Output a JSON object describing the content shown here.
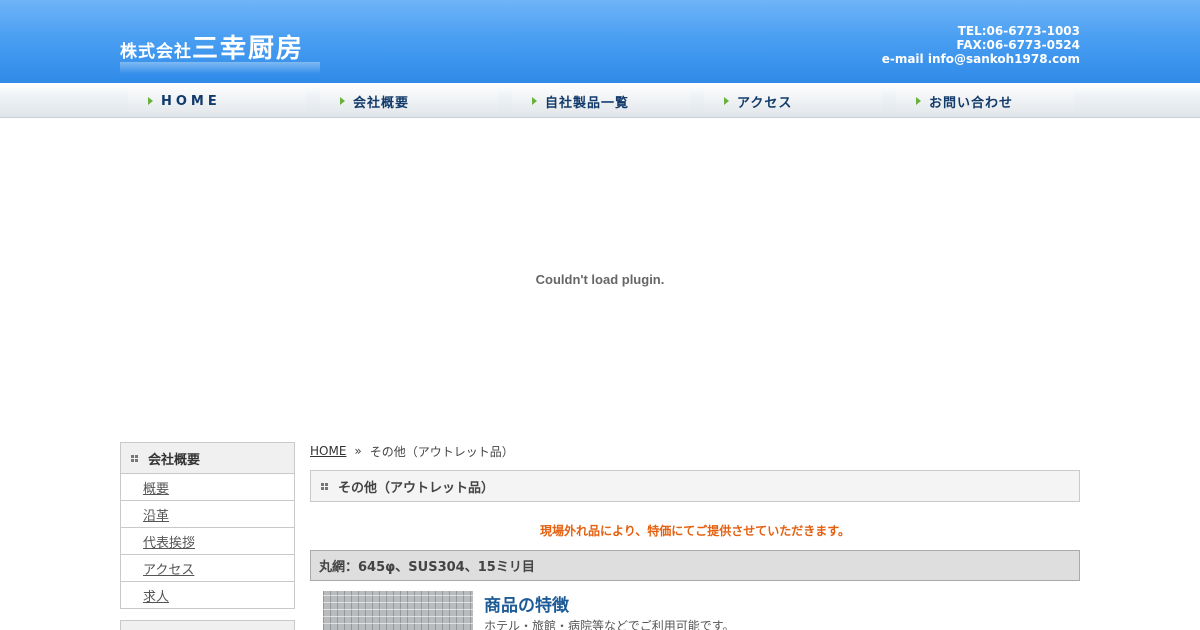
{
  "header": {
    "company_prefix": "株式会社",
    "company_name": "三幸厨房",
    "tel": "TEL:06-6773-1003",
    "fax": "FAX:06-6773-0524",
    "email": "e-mail info@sankoh1978.com"
  },
  "nav": {
    "items": [
      {
        "label": "HOME"
      },
      {
        "label": "会社概要"
      },
      {
        "label": "自社製品一覧"
      },
      {
        "label": "アクセス"
      },
      {
        "label": "お問い合わせ"
      }
    ]
  },
  "plugin": {
    "message": "Couldn't load plugin."
  },
  "sidebar": {
    "heading": "会社概要",
    "items": [
      {
        "label": "概要"
      },
      {
        "label": "沿革"
      },
      {
        "label": "代表挨拶"
      },
      {
        "label": "アクセス"
      },
      {
        "label": "求人"
      }
    ]
  },
  "breadcrumb": {
    "home": "HOME",
    "separator": "»",
    "current": "その他（アウトレット品）"
  },
  "main": {
    "title": "その他（アウトレット品）",
    "notice": "現場外れ品により、特価にてご提供させていただきます。",
    "product_title": "丸網：645φ、SUS304、15ミリ目",
    "feature_title": "商品の特徴",
    "feature_text": "ホテル・旅館・病院等などでご利用可能です。"
  },
  "colors": {
    "header_blue": "#4a9ff2",
    "nav_text": "#123a6b",
    "notice_orange": "#e5600f",
    "feature_blue": "#1d5b97"
  }
}
